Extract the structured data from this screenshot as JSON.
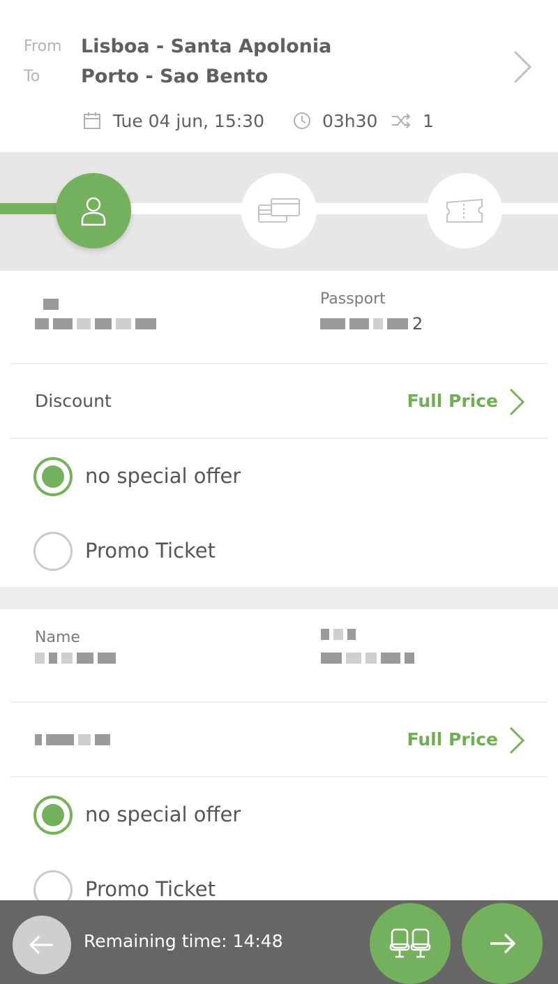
{
  "journey": {
    "from_label": "From",
    "to_label": "To",
    "from_station": "Lisboa - Santa Apolonia",
    "to_station": "Porto - Sao Bento",
    "date": "Tue 04 jun, 15:30",
    "duration": "03h30",
    "changes": "1"
  },
  "stepper": {
    "steps": [
      {
        "icon": "person-icon",
        "state": "active"
      },
      {
        "icon": "credit-cards-icon",
        "state": "inactive"
      },
      {
        "icon": "ticket-icon",
        "state": "inactive"
      }
    ]
  },
  "passenger1": {
    "document_label": "Passport",
    "document_value_suffix": "2",
    "discount_label": "Discount",
    "price_label": "Full Price",
    "options": [
      "no special offer",
      "Promo Ticket"
    ],
    "selected_option": "no special offer"
  },
  "passenger2": {
    "name_label": "Name",
    "price_label": "Full Price",
    "options": [
      "no special offer",
      "Promo Ticket"
    ],
    "selected_option": "no special offer"
  },
  "bottom": {
    "timer": "Remaining time: 14:48"
  },
  "colors": {
    "accent": "#75b05c",
    "bar": "#666666",
    "gap": "#e7e7e7"
  }
}
